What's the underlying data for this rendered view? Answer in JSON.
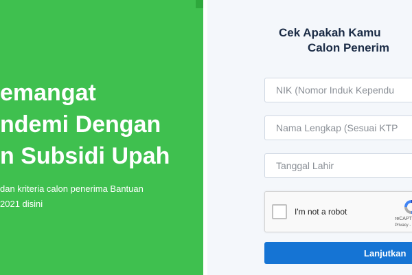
{
  "hero": {
    "headline_lines": [
      "emangat",
      "ndemi Dengan",
      "n Subsidi Upah"
    ],
    "subtitle_lines": [
      "dan kriteria calon penerima Bantuan",
      "2021 disini"
    ]
  },
  "form": {
    "title_lines": [
      "Cek Apakah Kamu",
      "Calon Penerim"
    ],
    "fields": {
      "nik_placeholder": "NIK (Nomor Induk Kependu",
      "name_placeholder": "Nama Lengkap (Sesuai KTP",
      "dob_placeholder": "Tanggal Lahir"
    },
    "recaptcha": {
      "label": "I'm not a robot",
      "brand": "reCAPT",
      "links": "Privacy -"
    },
    "submit_label": "Lanjutkan"
  },
  "colors": {
    "hero_green": "#3fc04f",
    "title_navy": "#1a2b45",
    "button_blue": "#1574d4",
    "panel_bg": "#f4f7fb"
  }
}
